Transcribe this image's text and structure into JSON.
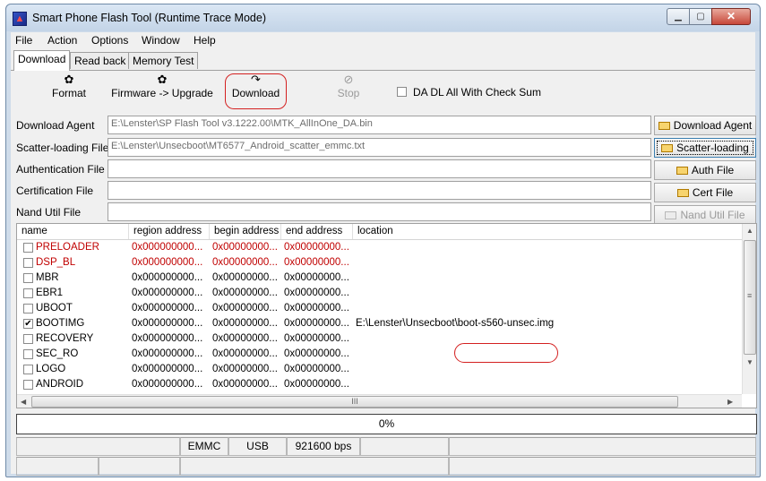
{
  "window": {
    "title": "Smart Phone Flash Tool (Runtime Trace Mode)"
  },
  "menu": [
    "File",
    "Action",
    "Options",
    "Window",
    "Help"
  ],
  "tabs": [
    "Download",
    "Read back",
    "Memory Test"
  ],
  "toolbar": {
    "format": "Format",
    "firmware_upgrade": "Firmware -> Upgrade",
    "download": "Download",
    "stop": "Stop",
    "checksum_label": "DA DL All With Check Sum",
    "checksum_checked": false
  },
  "fields": [
    {
      "label": "Download Agent",
      "value": "E:\\Lenster\\SP Flash Tool v3.1222.00\\MTK_AllInOne_DA.bin",
      "button": "Download Agent"
    },
    {
      "label": "Scatter-loading File",
      "value": "E:\\Lenster\\Unsecboot\\MT6577_Android_scatter_emmc.txt",
      "button": "Scatter-loading"
    },
    {
      "label": "Authentication File",
      "value": "",
      "button": "Auth File"
    },
    {
      "label": "Certification File",
      "value": "",
      "button": "Cert File"
    },
    {
      "label": "Nand Util File",
      "value": "",
      "button": "Nand Util File"
    }
  ],
  "table": {
    "columns": [
      "name",
      "region address",
      "begin address",
      "end address",
      "location"
    ],
    "rows": [
      {
        "name": "PRELOADER",
        "region": "0x000000000...",
        "begin": "0x00000000...",
        "end": "0x00000000...",
        "location": "",
        "checked": false,
        "red": true
      },
      {
        "name": "DSP_BL",
        "region": "0x000000000...",
        "begin": "0x00000000...",
        "end": "0x00000000...",
        "location": "",
        "checked": false,
        "red": true
      },
      {
        "name": "MBR",
        "region": "0x000000000...",
        "begin": "0x00000000...",
        "end": "0x00000000...",
        "location": "",
        "checked": false,
        "red": false
      },
      {
        "name": "EBR1",
        "region": "0x000000000...",
        "begin": "0x00000000...",
        "end": "0x00000000...",
        "location": "",
        "checked": false,
        "red": false
      },
      {
        "name": "UBOOT",
        "region": "0x000000000...",
        "begin": "0x00000000...",
        "end": "0x00000000...",
        "location": "",
        "checked": false,
        "red": false
      },
      {
        "name": "BOOTIMG",
        "region": "0x000000000...",
        "begin": "0x00000000...",
        "end": "0x00000000...",
        "location": "E:\\Lenster\\Unsecboot\\boot-s560-unsec.img",
        "checked": true,
        "red": false
      },
      {
        "name": "RECOVERY",
        "region": "0x000000000...",
        "begin": "0x00000000...",
        "end": "0x00000000...",
        "location": "",
        "checked": false,
        "red": false
      },
      {
        "name": "SEC_RO",
        "region": "0x000000000...",
        "begin": "0x00000000...",
        "end": "0x00000000...",
        "location": "",
        "checked": false,
        "red": false
      },
      {
        "name": "LOGO",
        "region": "0x000000000...",
        "begin": "0x00000000...",
        "end": "0x00000000...",
        "location": "",
        "checked": false,
        "red": false
      },
      {
        "name": "ANDROID",
        "region": "0x000000000...",
        "begin": "0x00000000...",
        "end": "0x00000000...",
        "location": "",
        "checked": false,
        "red": false
      }
    ]
  },
  "progress": {
    "text": "0%",
    "value": 0
  },
  "status": {
    "storage": "EMMC",
    "port": "USB",
    "baud": "921600 bps"
  },
  "colors": {
    "red_partition": "#c00000",
    "annotation_oval": "#d42020"
  }
}
